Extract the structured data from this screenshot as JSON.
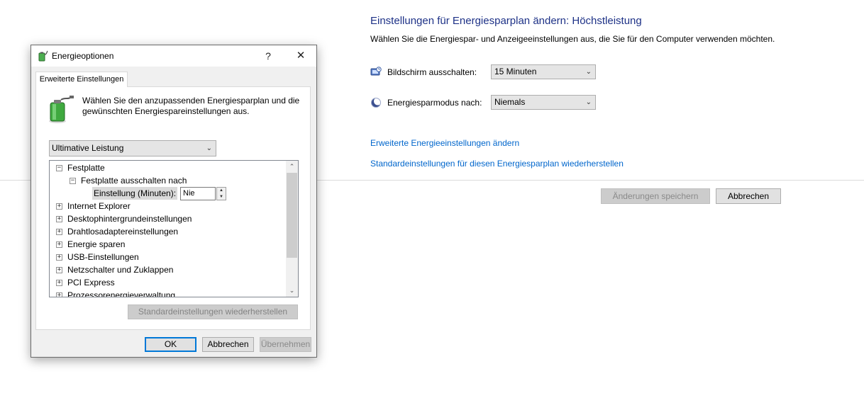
{
  "background": {
    "title": "Einstellungen für Energiesparplan ändern: Höchstleistung",
    "subtitle": "Wählen Sie die Energiespar- und Anzeigeeinstellungen aus, die Sie für den Computer verwenden möchten.",
    "display_off": {
      "label": "Bildschirm ausschalten:",
      "value": "15 Minuten",
      "icon": "monitor-icon"
    },
    "sleep_after": {
      "label": "Energiesparmodus nach:",
      "value": "Niemals",
      "icon": "moon-icon"
    },
    "advanced_link": "Erweiterte Energieeinstellungen ändern",
    "restore_link": "Standardeinstellungen für diesen Energiesparplan wiederherstellen",
    "save_button": "Änderungen speichern",
    "cancel_button": "Abbrechen"
  },
  "dialog": {
    "title": "Energieoptionen",
    "help_glyph": "?",
    "close_glyph": "✕",
    "tab_label": "Erweiterte Einstellungen",
    "description": "Wählen Sie den anzupassenden Energiesparplan und die gewünschten Energiespareinstellungen aus.",
    "plan_select": "Ultimative Leistung",
    "tree": {
      "festplatte": "Festplatte",
      "festplatte_aus": "Festplatte ausschalten nach",
      "setting_label": "Einstellung (Minuten):",
      "setting_value": "Nie",
      "items": [
        "Internet Explorer",
        "Desktophintergrundeinstellungen",
        "Drahtlosadaptereinstellungen",
        "Energie sparen",
        "USB-Einstellungen",
        "Netzschalter und Zuklappen",
        "PCI Express",
        "Prozessorenergieverwaltung"
      ]
    },
    "restore_defaults": "Standardeinstellungen wiederherstellen",
    "ok": "OK",
    "cancel": "Abbrechen",
    "apply": "Übernehmen"
  },
  "colors": {
    "title_blue": "#1e3287",
    "link_blue": "#0066cc",
    "focus_blue": "#0078d7"
  }
}
